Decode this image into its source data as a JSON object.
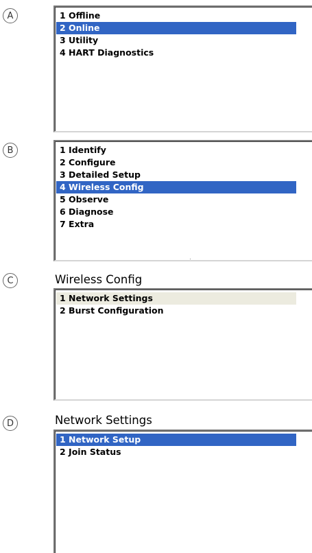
{
  "labels": {
    "a": "A",
    "b": "B",
    "c": "C",
    "d": "D"
  },
  "panel_a": {
    "items": [
      "1 Offline",
      "2 Online",
      "3 Utility",
      "4 HART Diagnostics"
    ],
    "selected": "2 Online"
  },
  "panel_b": {
    "items": [
      "1 Identify",
      "2 Configure",
      "3 Detailed Setup",
      "4 Wireless Config",
      "5 Observe",
      "6 Diagnose",
      "7 Extra"
    ],
    "selected": "4 Wireless Config"
  },
  "panel_c": {
    "title": "Wireless Config",
    "items": [
      "1 Network Settings",
      "2 Burst Configuration"
    ],
    "highlighted": "1 Network Settings"
  },
  "panel_d": {
    "title": "Network Settings",
    "items": [
      "1 Network Setup",
      "2 Join Status"
    ],
    "selected": "1 Network Setup"
  },
  "colors": {
    "selection": "#3165c4",
    "highlight": "#ecebdf"
  }
}
